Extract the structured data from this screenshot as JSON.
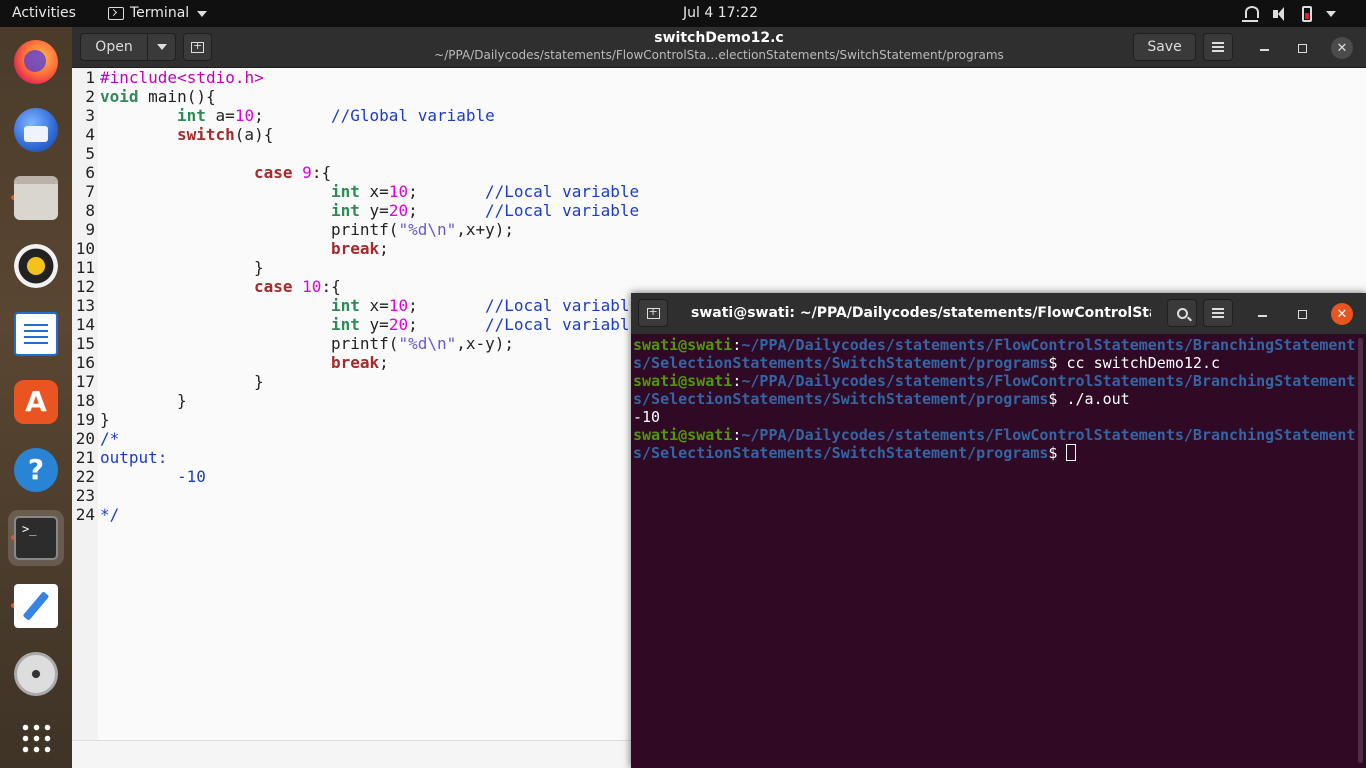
{
  "topbar": {
    "activities": "Activities",
    "app_name": "Terminal",
    "clock": "Jul 4  17:22"
  },
  "dock": {
    "items": [
      "firefox-icon",
      "thunderbird-icon",
      "files-icon",
      "rhythmbox-icon",
      "libreoffice-writer-icon",
      "app-center-icon",
      "help-icon",
      "terminal-icon",
      "text-editor-icon",
      "disc-icon",
      "show-apps-icon"
    ]
  },
  "gedit": {
    "open_label": "Open",
    "title": "switchDemo12.c",
    "path": "~/PPA/Dailycodes/statements/FlowControlSta…electionStatements/SwitchStatement/programs",
    "save_label": "Save",
    "lines": [
      {
        "n": "1"
      },
      {
        "n": "2"
      },
      {
        "n": "3"
      },
      {
        "n": "4"
      },
      {
        "n": "5"
      },
      {
        "n": "6"
      },
      {
        "n": "7"
      },
      {
        "n": "8"
      },
      {
        "n": "9"
      },
      {
        "n": "10"
      },
      {
        "n": "11"
      },
      {
        "n": "12"
      },
      {
        "n": "13"
      },
      {
        "n": "14"
      },
      {
        "n": "15"
      },
      {
        "n": "16"
      },
      {
        "n": "17"
      },
      {
        "n": "18"
      },
      {
        "n": "19"
      },
      {
        "n": "20"
      },
      {
        "n": "21"
      },
      {
        "n": "22"
      },
      {
        "n": "23"
      },
      {
        "n": "24"
      }
    ],
    "code": {
      "l1": "#include<stdio.h>",
      "l2a": "void",
      "l2b": " main(){",
      "l3a": "int",
      "l3b": " a=",
      "l3c": "10",
      "l3d": ";",
      "l3e": "//Global variable",
      "l4a": "switch",
      "l4b": "(a){",
      "l6a": "case",
      "l6b": " ",
      "l6c": "9",
      "l6d": ":{",
      "l7a": "int",
      "l7b": " x=",
      "l7c": "10",
      "l7d": ";",
      "l7e": "//Local variable",
      "l8a": "int",
      "l8b": " y=",
      "l8c": "20",
      "l8d": ";",
      "l8e": "//Local variable",
      "l9a": "printf(",
      "l9b": "\"%d\\n\"",
      "l9c": ",x+y);",
      "l10": "break",
      "l10b": ";",
      "l11": "}",
      "l12a": "case",
      "l12b": " ",
      "l12c": "10",
      "l12d": ":{",
      "l13a": "int",
      "l13b": " x=",
      "l13c": "10",
      "l13d": ";",
      "l13e": "//Local variabl",
      "l14a": "int",
      "l14b": " y=",
      "l14c": "20",
      "l14d": ";",
      "l14e": "//Local variabl",
      "l15a": "printf(",
      "l15b": "\"%d\\n\"",
      "l15c": ",x-y);",
      "l16": "break",
      "l16b": ";",
      "l17": "}",
      "l18": "}",
      "l19": "}",
      "l20": "/*",
      "l21": "output:",
      "l22": "-10",
      "l24": "*/"
    }
  },
  "terminal": {
    "title": "swati@swati: ~/PPA/Dailycodes/statements/FlowControlState...",
    "user": "swati@swati",
    "path_line1": "~/PPA/Dailycodes/statements/FlowControlStatements/BranchingStatement",
    "path_line2": "s/SelectionStatements/SwitchStatement/programs",
    "cmd1": "$ cc switchDemo12.c",
    "cmd2": "$ ./a.out",
    "output": "-10",
    "prompt": "$ "
  }
}
